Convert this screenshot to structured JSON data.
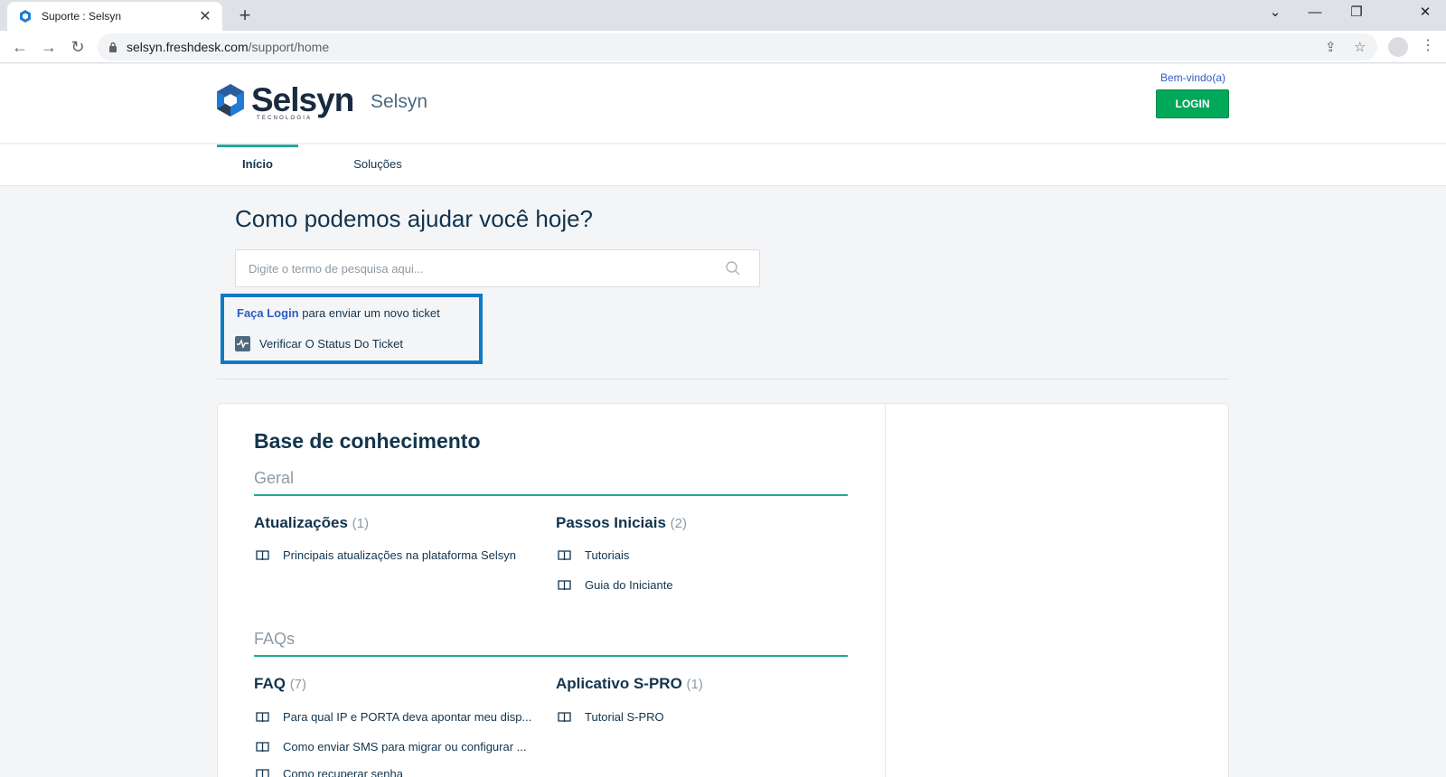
{
  "browser": {
    "tab_title": "Suporte : Selsyn",
    "url_host": "selsyn.freshdesk.com",
    "url_path": "/support/home"
  },
  "header": {
    "logo_word": "Selsyn",
    "logo_sub": "TECNOLOGIA",
    "brand_name": "Selsyn",
    "welcome": "Bem-vindo(a)",
    "login_label": "LOGIN"
  },
  "nav": {
    "items": [
      {
        "label": "Início",
        "active": true
      },
      {
        "label": "Soluções",
        "active": false
      }
    ]
  },
  "hero": {
    "title": "Como podemos ajudar você hoje?",
    "search_placeholder": "Digite o termo de pesquisa aqui...",
    "login_link": "Faça Login",
    "login_rest": "para enviar um novo ticket",
    "status_label": "Verificar O Status Do Ticket"
  },
  "kb": {
    "title": "Base de conhecimento",
    "categories": [
      {
        "name": "Geral",
        "folders": [
          {
            "name": "Atualizações",
            "count": "(1)",
            "articles": [
              "Principais atualizações na plataforma Selsyn"
            ]
          },
          {
            "name": "Passos Iniciais",
            "count": "(2)",
            "articles": [
              "Tutoriais",
              "Guia do Iniciante"
            ]
          }
        ]
      },
      {
        "name": "FAQs",
        "folders": [
          {
            "name": "FAQ",
            "count": "(7)",
            "articles": [
              "Para qual IP e PORTA deva apontar meu disp...",
              "Como enviar SMS para migrar ou configurar ...",
              "Como recuperar senha"
            ]
          },
          {
            "name": "Aplicativo S-PRO",
            "count": "(1)",
            "articles": [
              "Tutorial S-PRO"
            ]
          }
        ]
      }
    ]
  },
  "colors": {
    "accent_teal": "#26a69a",
    "login_green": "#00a85a",
    "link_blue": "#2c5cc5",
    "highlight_blue": "#0f7ac4"
  }
}
